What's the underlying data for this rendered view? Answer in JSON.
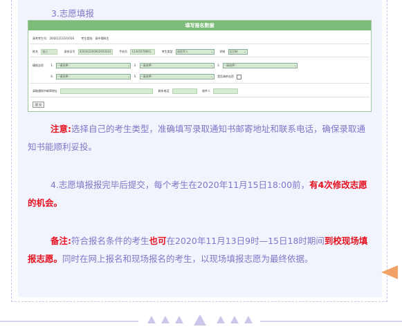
{
  "step3_title": "3.志愿填报",
  "form": {
    "header": "填写报名数据",
    "row1": {
      "exam_no_label": "高考考生号:",
      "exam_no": "20421213101016",
      "type_label": "考生类别:",
      "type": "高中理科生"
    },
    "row2": {
      "name_label": "姓名",
      "name": "张三",
      "id_label": "身份证号",
      "id": "420202200002020202",
      "phone_label": "手机号",
      "phone": "12345678901",
      "cat_label": "考生类型",
      "cat": "退役军人",
      "study_label": "学制",
      "study": "全日制"
    },
    "row3": {
      "choice_label": "填报志愿",
      "n1": "1.",
      "s1": "--请选择--",
      "n2": "2.",
      "s2": "--请选择--",
      "n3": "3.",
      "s3": "--请选择--"
    },
    "row4": {
      "n4": "4.",
      "s4": "--请选择--",
      "n5": "5.",
      "s5": "--请选择--",
      "adjust_label": "是否调剂志愿"
    },
    "row5": {
      "address_label": "录取通知书邮寄地址",
      "contact_label": "联系电话",
      "recipient_label": "收件人"
    },
    "submit_label": "提 交"
  },
  "note": {
    "label": "注意:",
    "text": "选择自己的考生类型，准确填写录取通知书邮寄地址和联系电话，确保录取通知书能顺利妥投。"
  },
  "step4": {
    "text": "4.志愿填报报完毕后提交，每个考生在2020年11月15日18:00前，",
    "highlight": "有4次修改志愿的机会。"
  },
  "remark": {
    "label": "备注:",
    "t1": "符合报名条件的考生",
    "h1": "也可",
    "t2": "在2020年11月13日9时—15日18时期间",
    "h2": "到校现场填报志愿。",
    "t3": "同时在网上报名和现场报名的考生，以现场填报志愿为最终依据。"
  },
  "colors": {
    "accent_text": "#7e78c8",
    "highlight": "#e8111f",
    "form_header": "#7cbc78",
    "arrow": "#f2a266"
  }
}
